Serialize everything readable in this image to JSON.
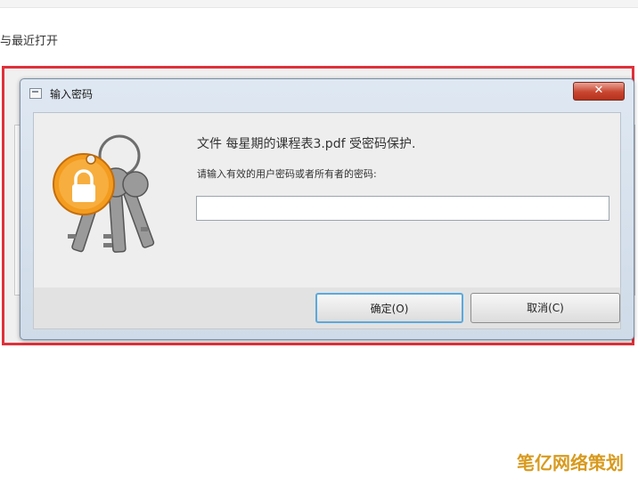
{
  "background": {
    "recent_label": "与最近打开"
  },
  "dialog": {
    "title": "输入密码",
    "close_label": "✕",
    "message": "文件 每星期的课程表3.pdf 受密码保护.",
    "prompt": "请输入有效的用户密码或者所有者的密码:",
    "password_value": "",
    "ok_label": "确定(O)",
    "cancel_label": "取消(C)"
  },
  "colors": {
    "highlight_border": "#e0303a",
    "close_button": "#c9452f",
    "default_button_border": "#5aa9dd",
    "key_ring_orange": "#f39c1f"
  },
  "icons": {
    "dialog_icon": "window-icon",
    "keys_icon": "keychain-lock-icon"
  },
  "watermark": "笔亿网络策划"
}
